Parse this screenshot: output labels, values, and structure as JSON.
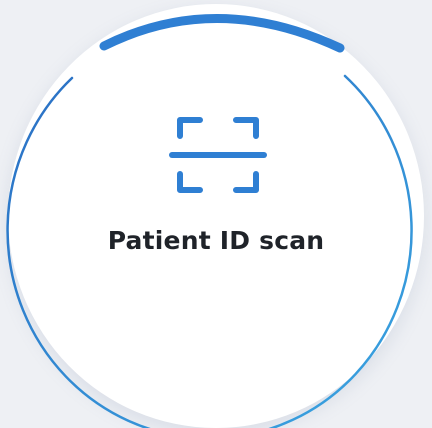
{
  "scan_button": {
    "label": "Patient ID scan",
    "icon": "scan-icon"
  },
  "colors": {
    "accent": "#2f7fd3",
    "ring_light": "#3aa0e0",
    "label": "#1f2329",
    "background": "#eef0f4",
    "disc": "#ffffff"
  }
}
